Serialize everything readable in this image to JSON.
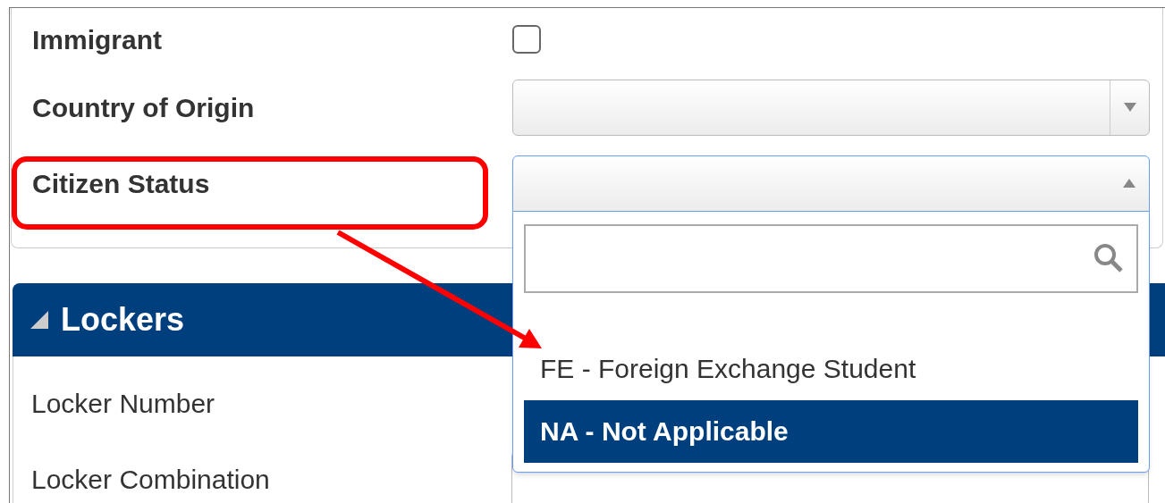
{
  "fields": [
    {
      "label": "Immigrant",
      "kind": "checkbox",
      "checked": false
    },
    {
      "label": "Country of Origin",
      "kind": "dropdown",
      "expanded": false
    },
    {
      "label": "Citizen Status",
      "kind": "dropdown",
      "expanded": true,
      "options": [
        {
          "label": "FE - Foreign Exchange Student",
          "selected": false
        },
        {
          "label": "NA - Not Applicable",
          "selected": true
        }
      ]
    }
  ],
  "lockers": {
    "title": "Lockers",
    "expanded": true,
    "fields": [
      {
        "label": "Locker Number",
        "kind": "label"
      },
      {
        "label": "Locker Combination",
        "kind": "text_field"
      }
    ]
  }
}
